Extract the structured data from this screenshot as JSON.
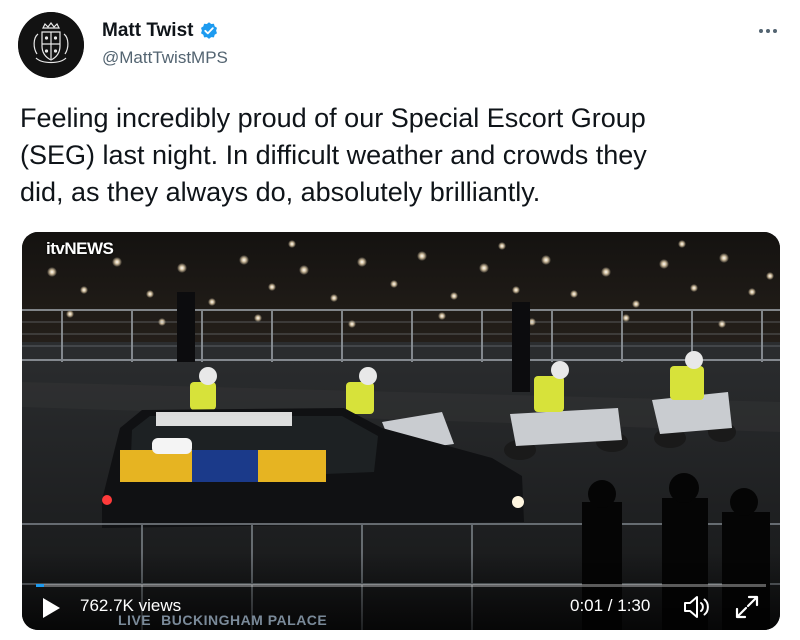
{
  "author": {
    "display_name": "Matt Twist",
    "handle": "@MattTwistMPS",
    "verified": true,
    "avatar_icon": "crest-icon"
  },
  "tweet": {
    "text_lines": [
      "Feeling incredibly proud of our Special Escort Group",
      "(SEG) last night. In difficult weather and crowds they",
      "did, as they always do, absolutely brilliantly."
    ]
  },
  "video": {
    "broadcaster_logo": "itvNEWS",
    "views": "762.7K views",
    "time": "0:01 / 1:30",
    "progress": 0.011,
    "live_label": "LIVE",
    "location_caption": "BUCKINGHAM PALACE"
  },
  "icons": {
    "more": "more-options-icon",
    "play": "play-icon",
    "volume": "volume-icon",
    "fullscreen": "fullscreen-icon"
  },
  "colors": {
    "verified_blue": "#1d9bf0",
    "text_primary": "#0f1419",
    "text_secondary": "#536471",
    "hi_vis_yellow": "#d7e23a",
    "royal_standard_red": "#c8102e",
    "royal_standard_gold": "#e6b422"
  }
}
